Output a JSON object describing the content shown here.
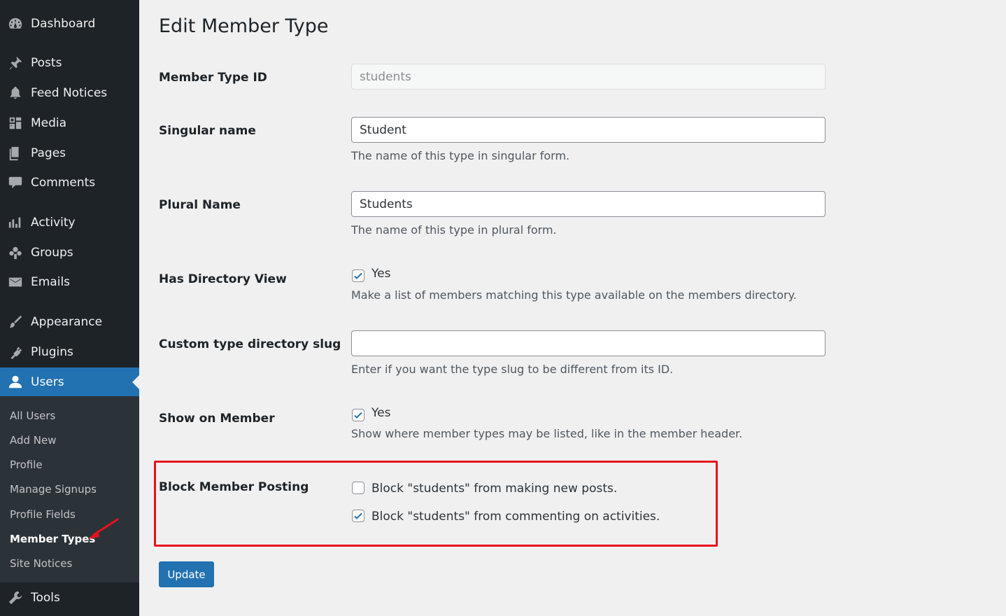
{
  "sidebar": {
    "menu": [
      {
        "label": "Dashboard",
        "icon": "dashboard-icon"
      },
      {
        "label": "Posts",
        "icon": "pin-icon"
      },
      {
        "label": "Feed Notices",
        "icon": "bell-icon"
      },
      {
        "label": "Media",
        "icon": "media-icon"
      },
      {
        "label": "Pages",
        "icon": "pages-icon"
      },
      {
        "label": "Comments",
        "icon": "comment-icon"
      },
      {
        "label": "Activity",
        "icon": "activity-icon"
      },
      {
        "label": "Groups",
        "icon": "groups-icon"
      },
      {
        "label": "Emails",
        "icon": "email-icon"
      },
      {
        "label": "Appearance",
        "icon": "brush-icon"
      },
      {
        "label": "Plugins",
        "icon": "plug-icon"
      },
      {
        "label": "Users",
        "icon": "user-icon"
      },
      {
        "label": "Tools",
        "icon": "wrench-icon"
      }
    ],
    "current_menu": "Users",
    "submenu": [
      {
        "label": "All Users"
      },
      {
        "label": "Add New"
      },
      {
        "label": "Profile"
      },
      {
        "label": "Manage Signups"
      },
      {
        "label": "Profile Fields"
      },
      {
        "label": "Member Types"
      },
      {
        "label": "Site Notices"
      }
    ],
    "current_submenu": "Member Types"
  },
  "page": {
    "title": "Edit Member Type",
    "fields": {
      "member_type_id": {
        "label": "Member Type ID",
        "value": "students"
      },
      "singular_name": {
        "label": "Singular name",
        "value": "Student",
        "description": "The name of this type in singular form."
      },
      "plural_name": {
        "label": "Plural Name",
        "value": "Students",
        "description": "The name of this type in plural form."
      },
      "has_directory": {
        "label": "Has Directory View",
        "checkbox_label": "Yes",
        "checked": true,
        "description": "Make a list of members matching this type available on the members directory."
      },
      "directory_slug": {
        "label": "Custom type directory slug",
        "value": "",
        "description": "Enter if you want the type slug to be different from its ID."
      },
      "show_on_member": {
        "label": "Show on Member",
        "checkbox_label": "Yes",
        "checked": true,
        "description": "Show where member types may be listed, like in the member header."
      },
      "block_posting": {
        "label": "Block Member Posting",
        "options": [
          {
            "label": "Block \"students\" from making new posts.",
            "checked": false
          },
          {
            "label": "Block \"students\" from commenting on activities.",
            "checked": true
          }
        ]
      }
    },
    "update_button": "Update"
  },
  "colors": {
    "sidebar_bg": "#1d2327",
    "submenu_bg": "#2c3338",
    "accent": "#2271b1",
    "highlight": "#e8111c"
  }
}
